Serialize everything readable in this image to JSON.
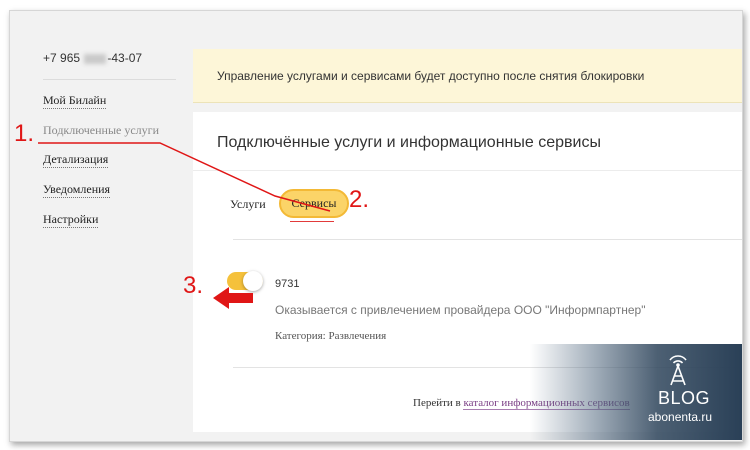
{
  "sidebar": {
    "phone_prefix": "+7 965",
    "phone_suffix": "-43-07",
    "items": [
      {
        "label": "Мой Билайн"
      },
      {
        "label": "Подключенные услуги"
      },
      {
        "label": "Детализация"
      },
      {
        "label": "Уведомления"
      },
      {
        "label": "Настройки"
      }
    ]
  },
  "notice": {
    "text": "Управление услугами и сервисами будет доступно после снятия блокировки"
  },
  "panel": {
    "title": "Подключённые услуги и информационные сервисы",
    "tabs": [
      {
        "label": "Услуги"
      },
      {
        "label": "Сервисы",
        "selected": true
      }
    ],
    "service": {
      "code": "9731",
      "enabled": true,
      "description": "Оказывается с привлечением провайдера ООО \"Информпартнер\"",
      "category": "Категория: Развлечения"
    },
    "footer_prefix": "Перейти в",
    "footer_link": "каталог информационных сервисов"
  },
  "annotations": {
    "step1": "1.",
    "step2": "2.",
    "step3": "3."
  },
  "watermark": {
    "brand": "BLOG",
    "site": "abonenta.ru"
  },
  "colors": {
    "accent_yellow": "#fbd468",
    "annotation_red": "#e01616",
    "link_purple": "#7a3e84",
    "notice_bg": "#fdf6d8"
  }
}
